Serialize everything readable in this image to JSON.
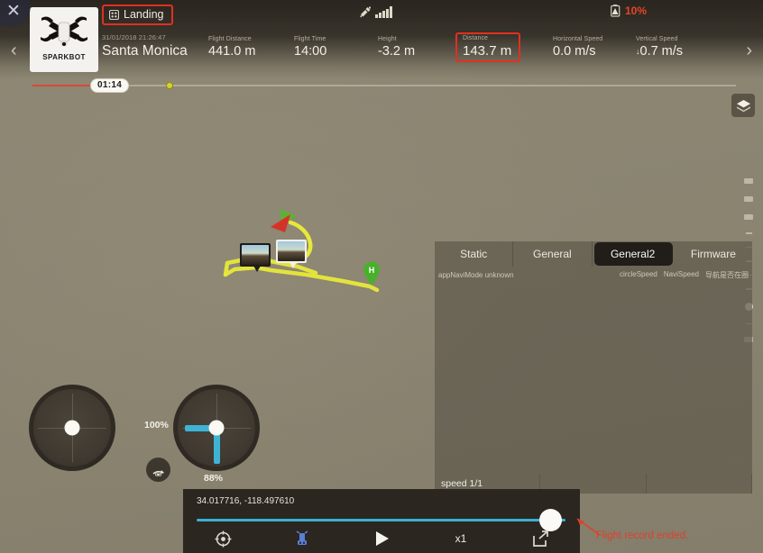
{
  "topbar": {
    "close_icon": "close-x-icon",
    "nav_prev": "‹",
    "nav_next": "›",
    "drone_name": "SPARKBOT",
    "status": {
      "label": "Landing",
      "icon": "landing-icon"
    },
    "signal": {
      "gps_icon": "satellite-icon",
      "bars_icon": "signal-bars-icon"
    },
    "battery": {
      "percent": "10%",
      "icon": "battery-warning-icon",
      "color": "#e5442b"
    }
  },
  "flight_info": {
    "datetime": "31/01/2018 21:26:47",
    "location": "Santa Monica",
    "metrics": [
      {
        "label": "Flight Distance",
        "value": "441.0 m"
      },
      {
        "label": "Flight Time",
        "value": "14:00"
      },
      {
        "label": "Height",
        "value": "-3.2 m"
      },
      {
        "label": "Distance",
        "value": "143.7 m",
        "highlight": "#e03020"
      },
      {
        "label": "Horizontal Speed",
        "value": "0.0 m/s"
      },
      {
        "label": "Vertical Speed",
        "value": "0.7 m/s",
        "prefix": "↓"
      }
    ]
  },
  "timeline": {
    "current_time": "01:14",
    "marker_icon": "event-marker-icon"
  },
  "map": {
    "layers_button_icon": "map-layers-icon",
    "home_marker_label": "H",
    "drone_marker_icon": "drone-heading-icon",
    "photo_markers": [
      "photo-thumbnail-a",
      "photo-thumbnail-b"
    ],
    "zoom_slider_icon": "map-zoom-slider"
  },
  "sticks": {
    "left_stick_name": "left-control-stick",
    "right_stick_name": "right-control-stick",
    "left_percent": "100%",
    "bottom_percent": "88%",
    "rth_icon": "return-to-home-icon"
  },
  "data_panel": {
    "tabs": [
      {
        "label": "Static",
        "active": false
      },
      {
        "label": "General",
        "active": false
      },
      {
        "label": "General2",
        "active": true
      },
      {
        "label": "Firmware",
        "active": false
      }
    ],
    "row_left": "appNaviMode unknown",
    "row_right_1": "circleSpeed",
    "row_right_2": "NaviSpeed",
    "row_right_3": "导航是否在圈",
    "footer_cells": [
      "speed 1/1",
      "",
      ""
    ]
  },
  "playback": {
    "coordinates": "34.017716, -118.497610",
    "progress_percent": 100,
    "controls": [
      {
        "name": "recenter-icon",
        "label": ""
      },
      {
        "name": "drone-tracking-icon",
        "label": ""
      },
      {
        "name": "play-icon",
        "label": ""
      },
      {
        "name": "speed-multiplier",
        "label": "x1"
      },
      {
        "name": "share-export-icon",
        "label": ""
      }
    ]
  },
  "annotation": {
    "text": "Flight record ended.",
    "color": "#e0402c"
  }
}
